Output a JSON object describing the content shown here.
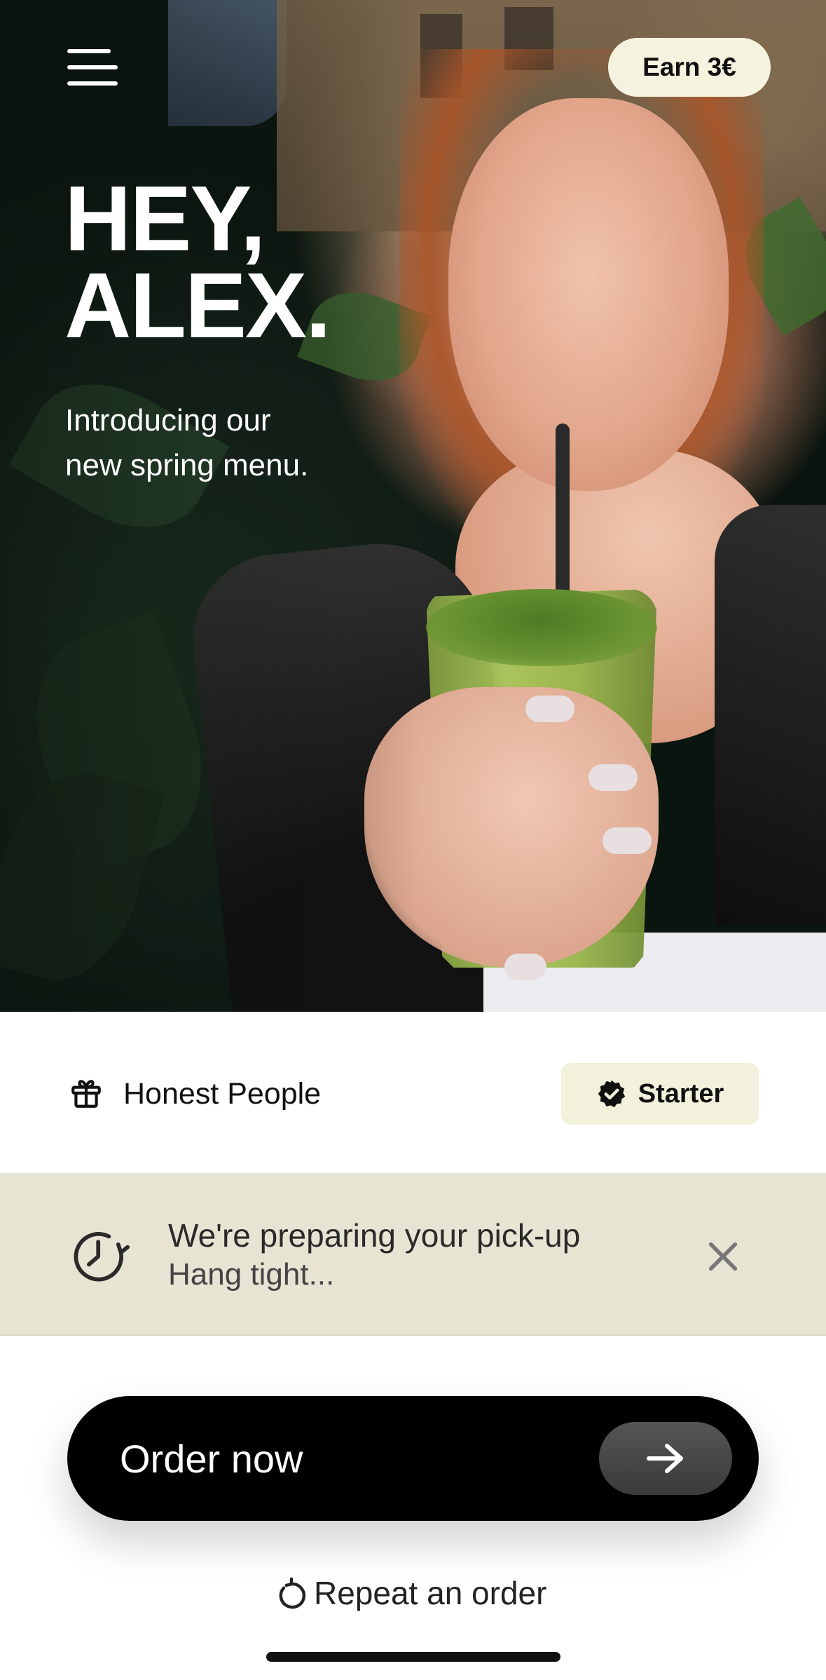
{
  "header": {
    "earn_label": "Earn 3€"
  },
  "hero": {
    "greeting_line1": "HEY,",
    "greeting_line2": "ALEX.",
    "intro_line1": "Introducing our",
    "intro_line2": "new spring menu."
  },
  "membership": {
    "name": "Honest People",
    "tier": "Starter"
  },
  "status": {
    "title": "We're preparing your pick-up",
    "subtitle": "Hang tight..."
  },
  "actions": {
    "order_label": "Order now",
    "repeat_label": "Repeat an order"
  },
  "colors": {
    "earn_bg": "#f5f3df",
    "tier_bg": "#f1f1dc",
    "status_bg": "#e8e4d3",
    "order_bg": "#000000"
  },
  "icons": {
    "menu": "hamburger-icon",
    "gift": "gift-icon",
    "tier": "verified-badge-icon",
    "status": "clock-refresh-icon",
    "close": "close-icon",
    "arrow": "arrow-right-icon",
    "repeat": "repeat-icon"
  }
}
